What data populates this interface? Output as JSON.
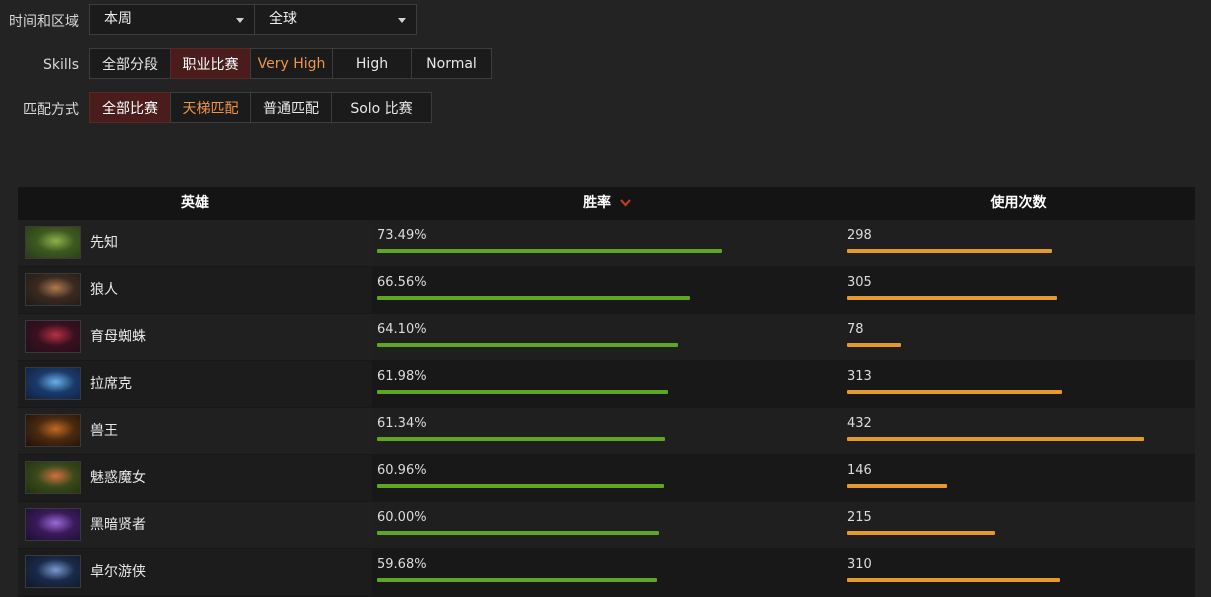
{
  "filters": {
    "time_label": "时间和区域",
    "time_value": "本周",
    "region_value": "全球",
    "skills_label": "Skills",
    "skills_options": [
      "全部分段",
      "职业比赛",
      "Very High",
      "High",
      "Normal"
    ],
    "mode_label": "匹配方式",
    "mode_options": [
      "全部比赛",
      "天梯匹配",
      "普通匹配",
      "Solo 比赛"
    ]
  },
  "table": {
    "headers": {
      "hero": "英雄",
      "winrate": "胜率",
      "uses": "使用次数"
    },
    "rows": [
      {
        "hero": "先知",
        "winrate": "73.49%",
        "winrate_value": 73.49,
        "uses": "298",
        "uses_value": 298
      },
      {
        "hero": "狼人",
        "winrate": "66.56%",
        "winrate_value": 66.56,
        "uses": "305",
        "uses_value": 305
      },
      {
        "hero": "育母蜘蛛",
        "winrate": "64.10%",
        "winrate_value": 64.1,
        "uses": "78",
        "uses_value": 78
      },
      {
        "hero": "拉席克",
        "winrate": "61.98%",
        "winrate_value": 61.98,
        "uses": "313",
        "uses_value": 313
      },
      {
        "hero": "兽王",
        "winrate": "61.34%",
        "winrate_value": 61.34,
        "uses": "432",
        "uses_value": 432
      },
      {
        "hero": "魅惑魔女",
        "winrate": "60.96%",
        "winrate_value": 60.96,
        "uses": "146",
        "uses_value": 146
      },
      {
        "hero": "黑暗贤者",
        "winrate": "60.00%",
        "winrate_value": 60.0,
        "uses": "215",
        "uses_value": 215
      },
      {
        "hero": "卓尔游侠",
        "winrate": "59.68%",
        "winrate_value": 59.68,
        "uses": "310",
        "uses_value": 310
      }
    ]
  },
  "colors": {
    "winrate_bar": "#5ea821",
    "uses_bar": "#e59a2c",
    "active_segment": "#4a1c1c",
    "highlight_text": "#f0944a",
    "sort_icon": "#c0392b"
  },
  "icons": {
    "sort": "chevron-down-icon",
    "dropdown": "caret-down-icon"
  }
}
